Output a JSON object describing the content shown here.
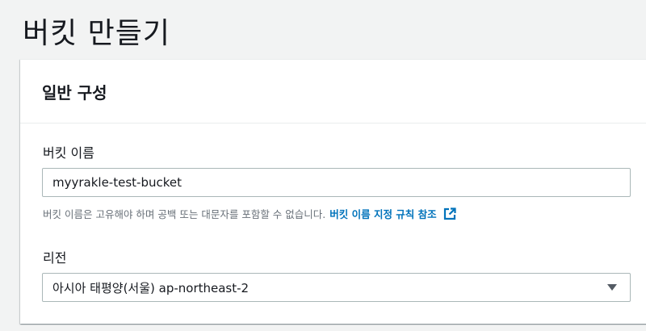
{
  "page": {
    "title": "버킷 만들기"
  },
  "general_config": {
    "title": "일반 구성",
    "bucket_name": {
      "label": "버킷 이름",
      "value": "myyrakle-test-bucket",
      "hint": "버킷 이름은 고유해야 하며 공백 또는 대문자를 포함할 수 없습니다.",
      "link": "버킷 이름 지정 규칙 참조",
      "link_icon": "external-link-icon"
    },
    "region": {
      "label": "리전",
      "selected": "아시아 태평양(서울) ap-northeast-2",
      "caret_icon": "caret-down-icon"
    }
  },
  "colors": {
    "background": "#f2f3f3",
    "link": "#0073bb",
    "border": "#aab7b8",
    "hint_text": "#687078"
  }
}
